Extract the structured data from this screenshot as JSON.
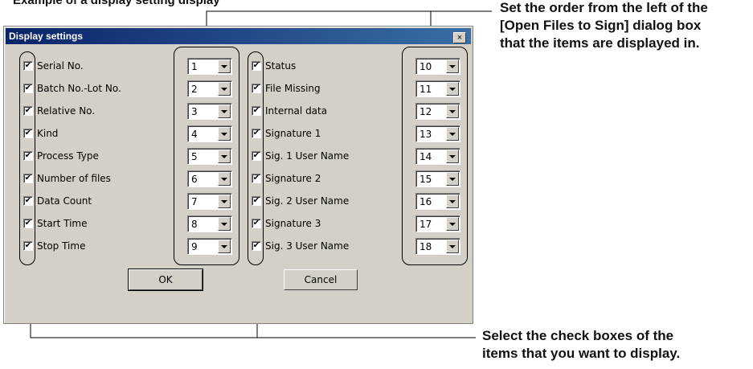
{
  "heading": "Example of a display setting display",
  "annotations": {
    "top": [
      "Set the order from the left of the",
      "[Open Files to Sign] dialog box",
      "that the items are displayed in."
    ],
    "bottom": [
      "Select the check boxes of the",
      "items that you want to display."
    ]
  },
  "dialog": {
    "title": "Display settings",
    "close_label": "×",
    "check_mark": "✔",
    "left_items": [
      {
        "label": "Serial No.",
        "order": "1",
        "checked": true
      },
      {
        "label": "Batch No.-Lot No.",
        "order": "2",
        "checked": true
      },
      {
        "label": "Relative No.",
        "order": "3",
        "checked": true
      },
      {
        "label": "Kind",
        "order": "4",
        "checked": true
      },
      {
        "label": "Process Type",
        "order": "5",
        "checked": true
      },
      {
        "label": "Number of files",
        "order": "6",
        "checked": true
      },
      {
        "label": "Data Count",
        "order": "7",
        "checked": true
      },
      {
        "label": "Start Time",
        "order": "8",
        "checked": true
      },
      {
        "label": "Stop Time",
        "order": "9",
        "checked": true
      }
    ],
    "right_items": [
      {
        "label": "Status",
        "order": "10",
        "checked": true
      },
      {
        "label": "File Missing",
        "order": "11",
        "checked": true
      },
      {
        "label": "Internal data",
        "order": "12",
        "checked": true
      },
      {
        "label": "Signature 1",
        "order": "13",
        "checked": true
      },
      {
        "label": "Sig. 1 User Name",
        "order": "14",
        "checked": true
      },
      {
        "label": "Signature 2",
        "order": "15",
        "checked": true
      },
      {
        "label": "Sig. 2 User Name",
        "order": "16",
        "checked": true
      },
      {
        "label": "Signature 3",
        "order": "17",
        "checked": true
      },
      {
        "label": "Sig. 3 User Name",
        "order": "18",
        "checked": true
      }
    ],
    "ok_label": "OK",
    "cancel_label": "Cancel"
  }
}
